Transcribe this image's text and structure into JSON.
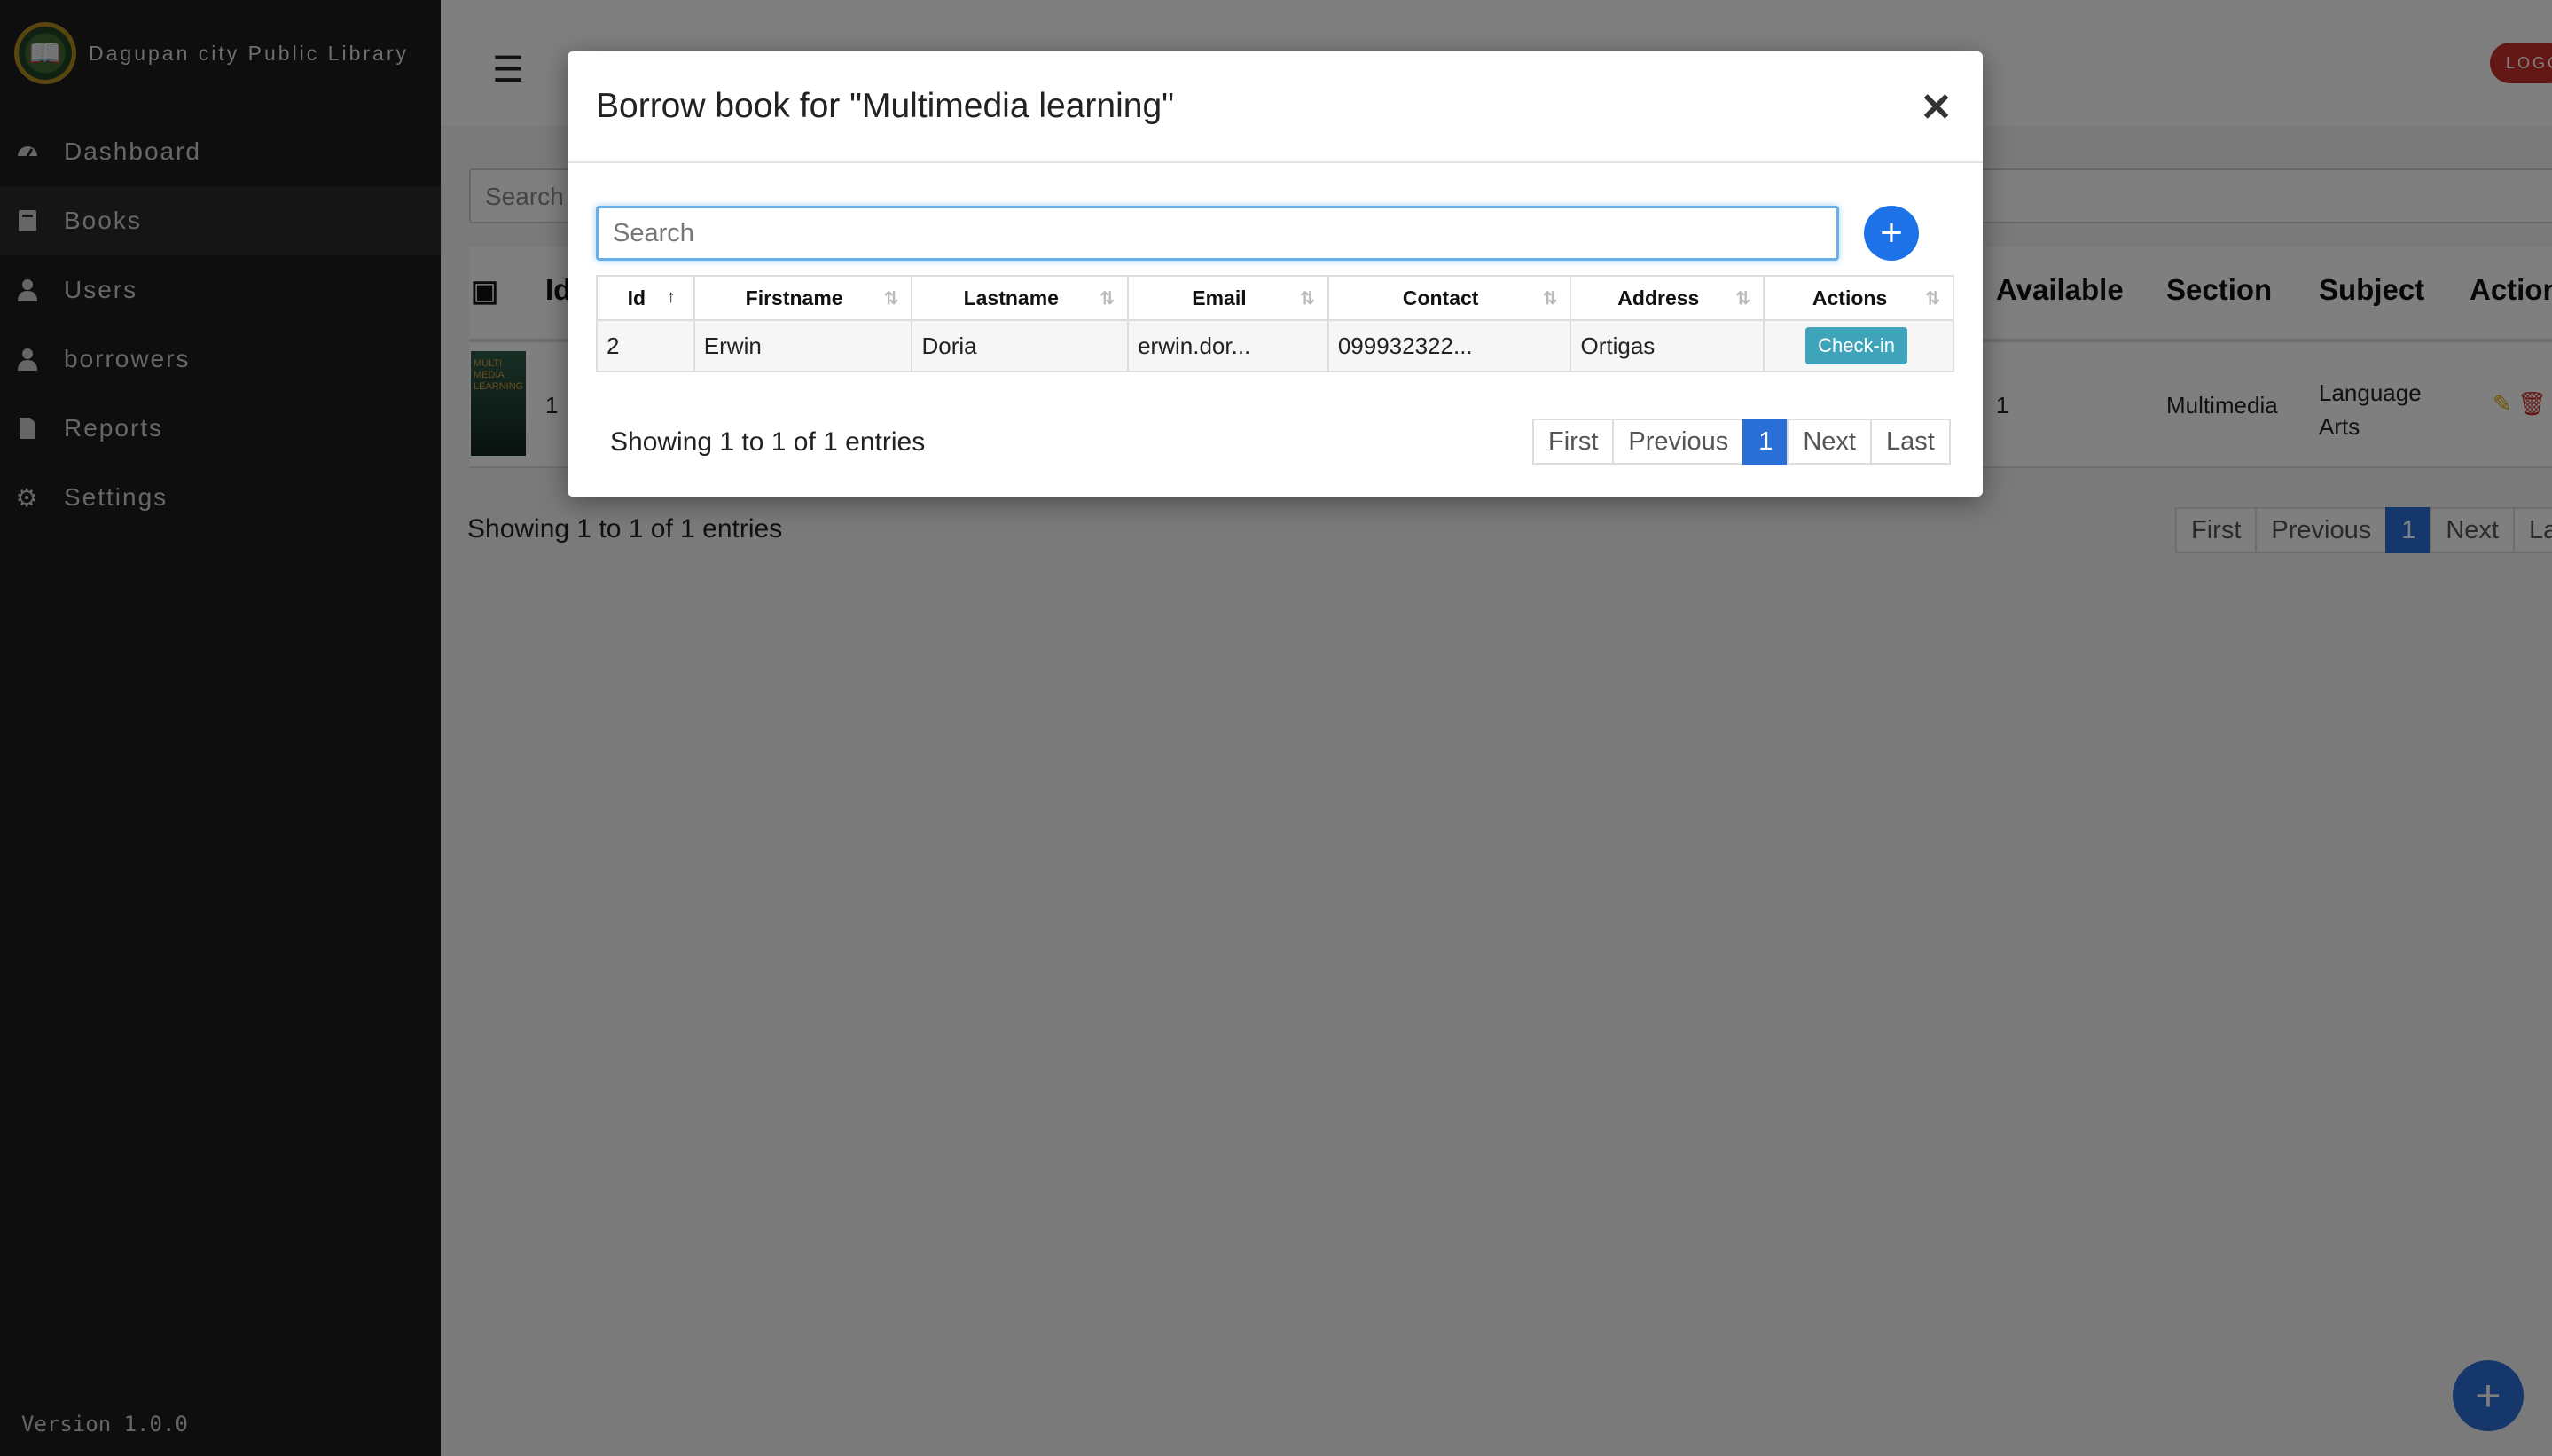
{
  "sidebar": {
    "brand": "Dagupan city Public Library",
    "items": [
      {
        "label": "Dashboard",
        "icon": "dashboard-icon"
      },
      {
        "label": "Books",
        "icon": "book-icon"
      },
      {
        "label": "Users",
        "icon": "user-icon"
      },
      {
        "label": "borrowers",
        "icon": "user-icon"
      },
      {
        "label": "Reports",
        "icon": "file-icon"
      },
      {
        "label": "Settings",
        "icon": "gear-icon"
      }
    ],
    "version": "Version 1.0.0"
  },
  "topbar": {
    "logout": "LOGOUT"
  },
  "books": {
    "search_placeholder": "Search",
    "headers": [
      "Id",
      "Available",
      "Section",
      "Subject",
      "Action"
    ],
    "row": {
      "id": "1",
      "available": "1",
      "section": "Multimedia",
      "subject": "Language Arts",
      "cover_text": "MULTI MEDIA LEARNING"
    },
    "showing": "Showing 1 to 1 of 1 entries",
    "pager": [
      "First",
      "Previous",
      "1",
      "Next",
      "Last"
    ]
  },
  "modal": {
    "title": "Borrow book for \"Multimedia learning\"",
    "search_placeholder": "Search",
    "headers": [
      "Id",
      "Firstname",
      "Lastname",
      "Email",
      "Contact",
      "Address",
      "Actions"
    ],
    "rows": [
      {
        "id": "2",
        "firstname": "Erwin",
        "lastname": "Doria",
        "email": "erwin.dor...",
        "contact": "099932322...",
        "address": "Ortigas",
        "action": "Check-in"
      }
    ],
    "showing": "Showing 1 to 1 of 1 entries",
    "pager": [
      "First",
      "Previous",
      "1",
      "Next",
      "Last"
    ]
  }
}
